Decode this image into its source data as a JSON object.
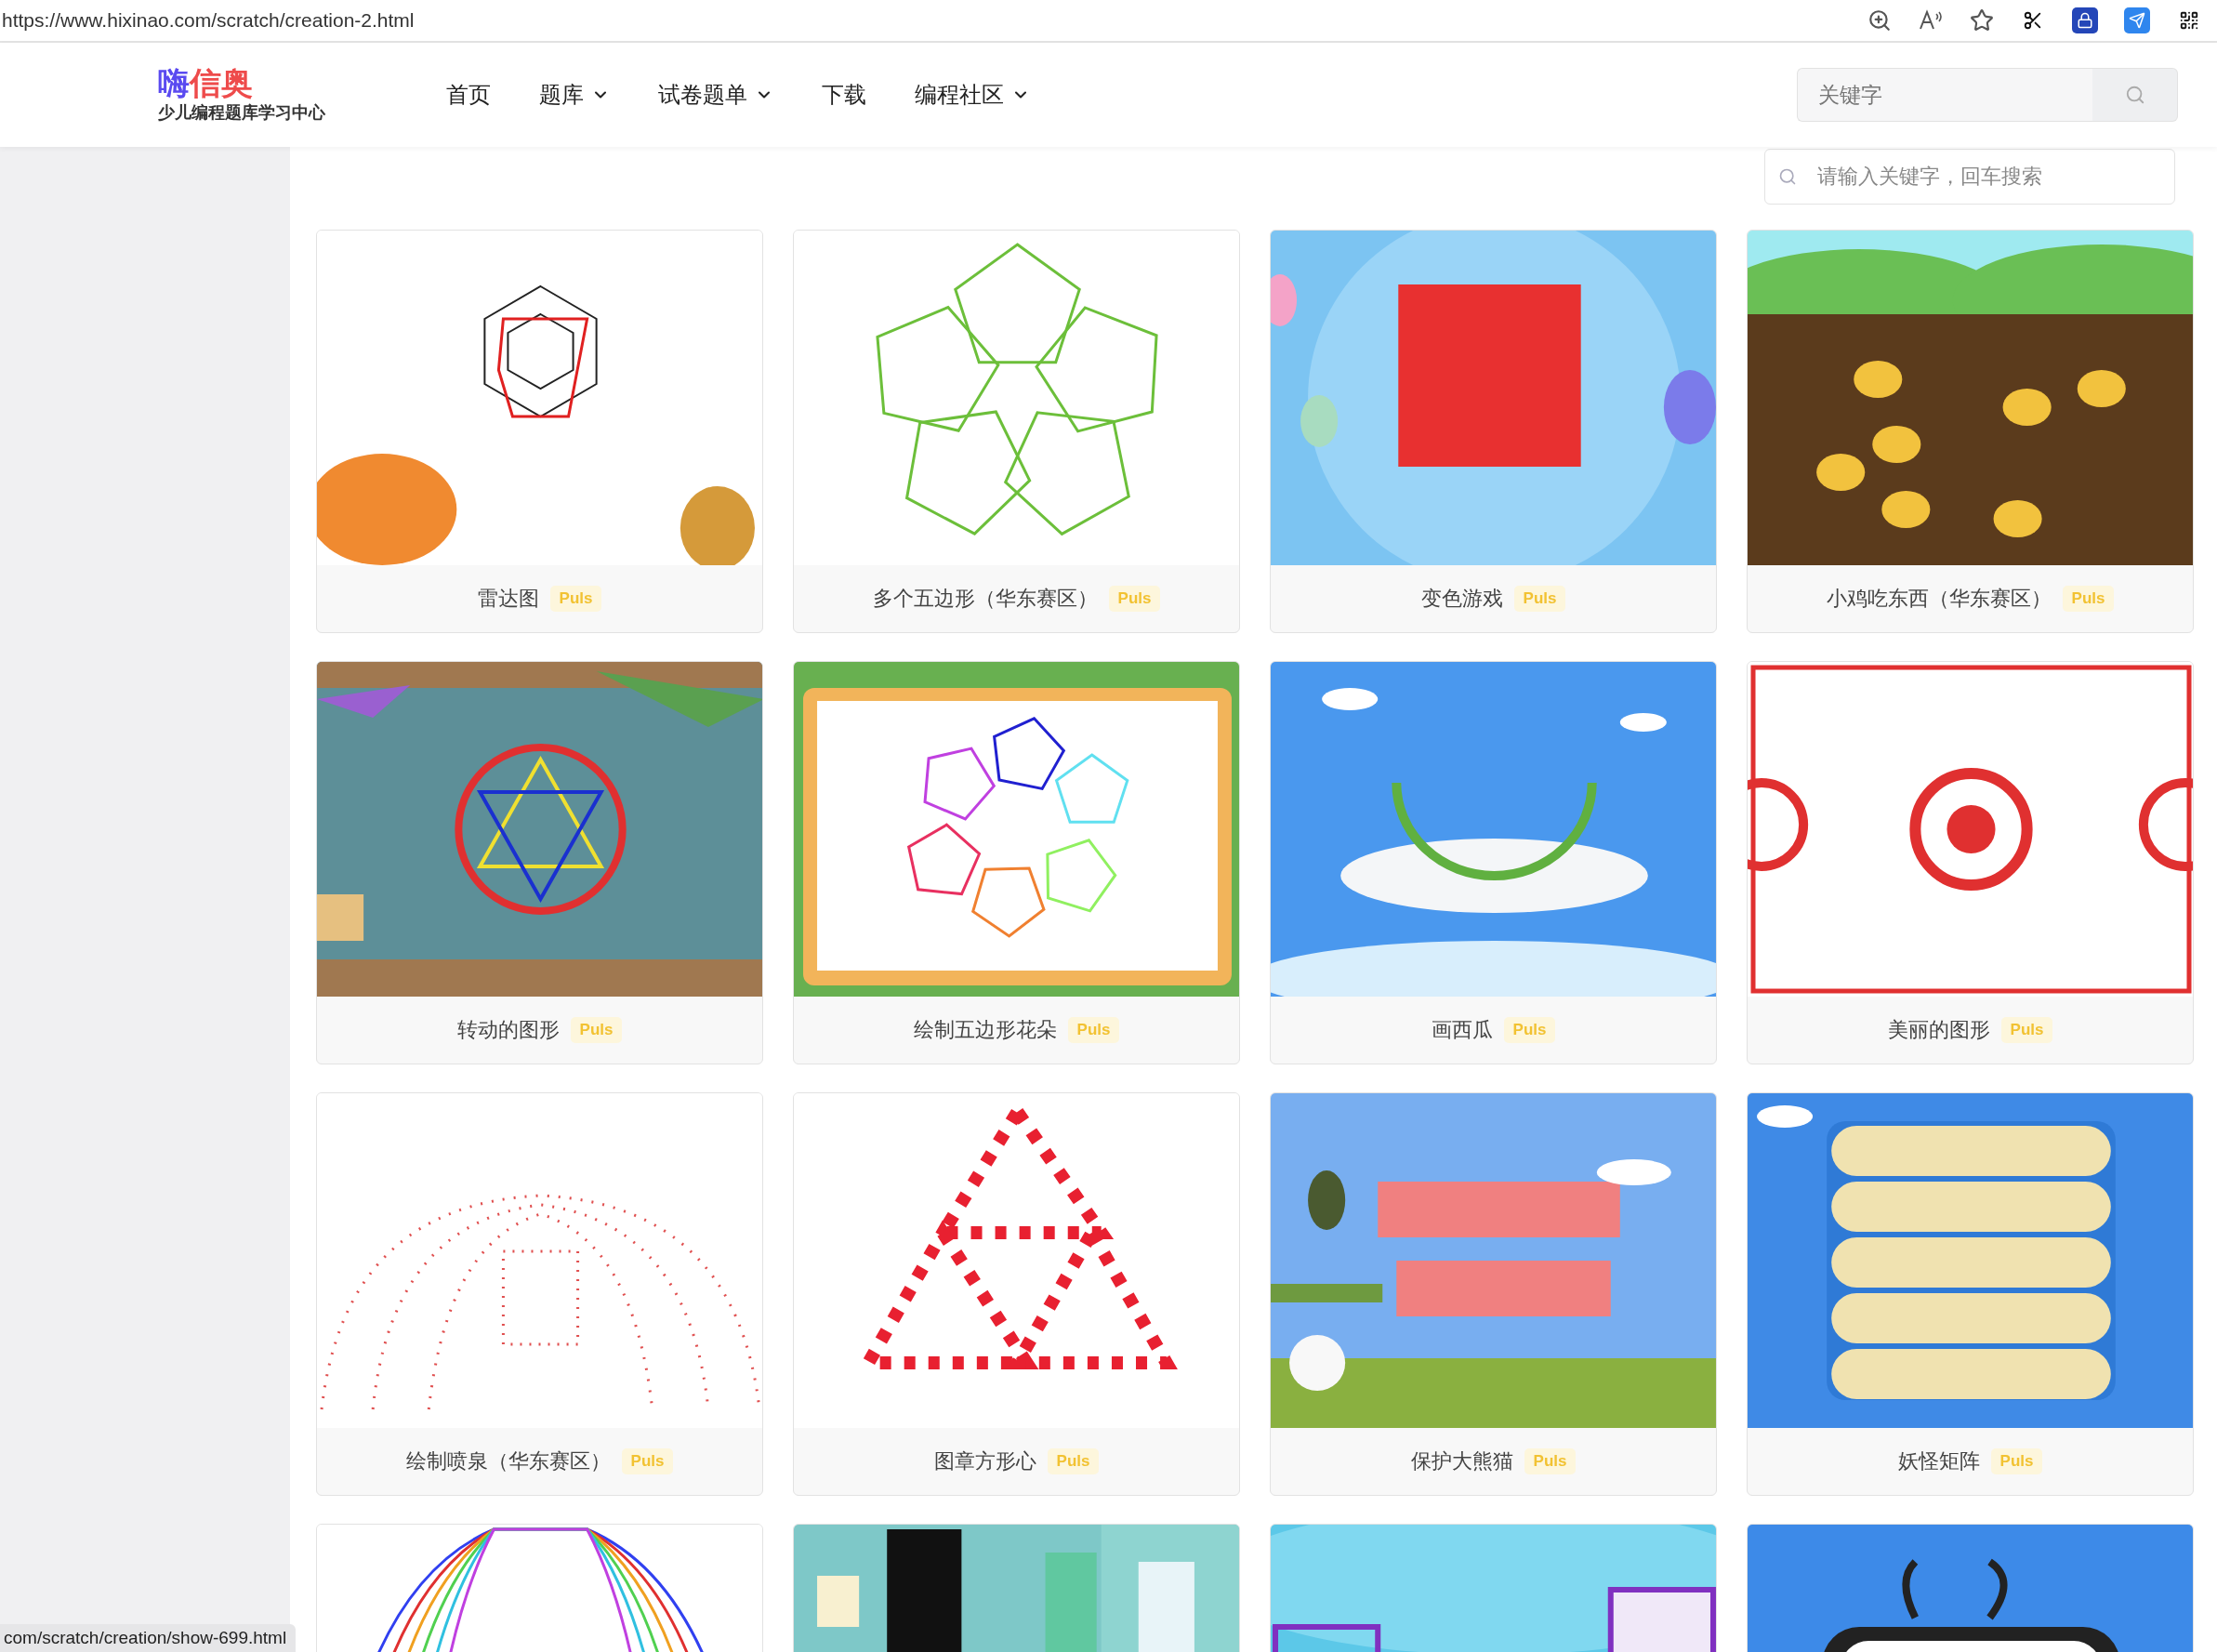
{
  "browser": {
    "url": "https://www.hixinao.com/scratch/creation-2.html",
    "status_link": "com/scratch/creation/show-699.html"
  },
  "header": {
    "logo": {
      "mark_a": "嗨",
      "mark_b": "信奥",
      "subtitle": "少儿编程题库学习中心"
    },
    "nav": [
      {
        "label": "首页",
        "dropdown": false
      },
      {
        "label": "题库",
        "dropdown": true
      },
      {
        "label": "试卷题单",
        "dropdown": true
      },
      {
        "label": "下载",
        "dropdown": false
      },
      {
        "label": "编程社区",
        "dropdown": true
      }
    ],
    "search": {
      "placeholder": "关键字"
    }
  },
  "content": {
    "search": {
      "placeholder": "请输入关键字，回车搜索"
    },
    "cards": [
      {
        "kind": "captioned",
        "title": "雷达图",
        "badge": "Puls"
      },
      {
        "kind": "captioned",
        "title": "多个五边形（华东赛区）",
        "badge": "Puls"
      },
      {
        "kind": "captioned",
        "title": "变色游戏",
        "badge": "Puls"
      },
      {
        "kind": "captioned",
        "title": "小鸡吃东西（华东赛区）",
        "badge": "Puls"
      },
      {
        "kind": "captioned",
        "title": "转动的图形",
        "badge": "Puls"
      },
      {
        "kind": "captioned",
        "title": "绘制五边形花朵",
        "badge": "Puls"
      },
      {
        "kind": "captioned",
        "title": "画西瓜",
        "badge": "Puls"
      },
      {
        "kind": "captioned",
        "title": "美丽的图形",
        "badge": "Puls"
      },
      {
        "kind": "captioned",
        "title": "绘制喷泉（华东赛区）",
        "badge": "Puls"
      },
      {
        "kind": "captioned",
        "title": "图章方形心",
        "badge": "Puls"
      },
      {
        "kind": "captioned",
        "title": "保护大熊猫",
        "badge": "Puls"
      },
      {
        "kind": "captioned",
        "title": "妖怪矩阵",
        "badge": "Puls"
      },
      {
        "kind": "picture"
      },
      {
        "kind": "picture"
      },
      {
        "kind": "picture"
      },
      {
        "kind": "picture"
      }
    ]
  }
}
